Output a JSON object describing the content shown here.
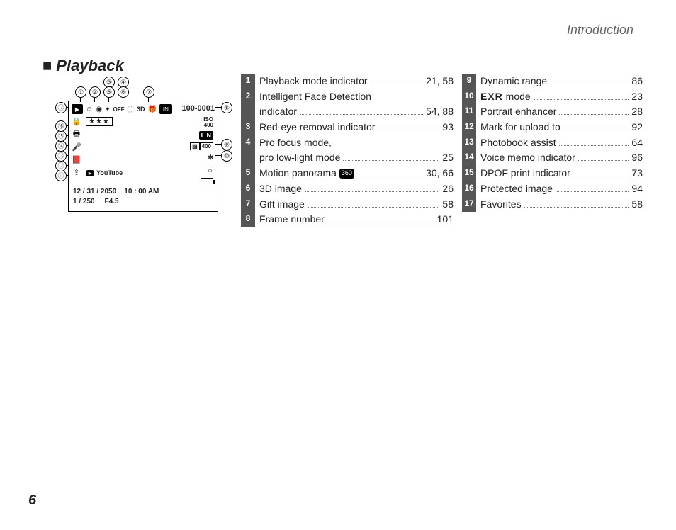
{
  "header": {
    "running": "Introduction"
  },
  "section": {
    "marker": "■",
    "title": "Playback"
  },
  "footer": {
    "page": "6"
  },
  "lcd": {
    "frame_number": "100-0001",
    "iso_label": "ISO",
    "iso_value": "400",
    "size_quality": "L N",
    "dynamic_badge": "400",
    "stars": "★★★",
    "youtube": "YouTube",
    "date": "12 / 31 / 2050",
    "time": "10 : 00  AM",
    "shutter": "1 / 250",
    "aperture": "F4.5"
  },
  "callouts_top": [
    "①",
    "②",
    "③",
    "④",
    "⑤",
    "⑥",
    "⑦"
  ],
  "callouts_side": [
    "⑧",
    "⑨",
    "⑩",
    "⑪",
    "⑫",
    "⑬",
    "⑭",
    "⑮",
    "⑯",
    "⑰"
  ],
  "legend_left": [
    {
      "n": "1",
      "lines": [
        {
          "label": "Playback mode indicator",
          "pg": "21, 58"
        }
      ]
    },
    {
      "n": "2",
      "lines": [
        {
          "label": "Intelligent Face Detection",
          "pg": ""
        },
        {
          "label": "indicator",
          "pg": "54, 88"
        }
      ]
    },
    {
      "n": "3",
      "lines": [
        {
          "label": "Red-eye removal indicator",
          "pg": "93"
        }
      ]
    },
    {
      "n": "4",
      "lines": [
        {
          "label": "Pro focus mode,",
          "pg": ""
        },
        {
          "label": "pro low-light mode",
          "pg": "25"
        }
      ]
    },
    {
      "n": "5",
      "lines": [
        {
          "label": "Motion panorama ",
          "icon": "360",
          "pg": "30, 66"
        }
      ]
    },
    {
      "n": "6",
      "lines": [
        {
          "label": "3D image",
          "pg": "26"
        }
      ]
    },
    {
      "n": "7",
      "lines": [
        {
          "label": "Gift image",
          "pg": "58"
        }
      ]
    },
    {
      "n": "8",
      "lines": [
        {
          "label": "Frame number",
          "pg": "101"
        }
      ]
    }
  ],
  "legend_right": [
    {
      "n": "9",
      "lines": [
        {
          "label": "Dynamic range",
          "pg": "86"
        }
      ]
    },
    {
      "n": "10",
      "lines": [
        {
          "label": "",
          "exr": true,
          "suffix": " mode",
          "pg": "23"
        }
      ]
    },
    {
      "n": "11",
      "lines": [
        {
          "label": "Portrait enhancer",
          "pg": "28"
        }
      ]
    },
    {
      "n": "12",
      "lines": [
        {
          "label": "Mark for upload to",
          "pg": "92"
        }
      ]
    },
    {
      "n": "13",
      "lines": [
        {
          "label": "Photobook assist",
          "pg": "64"
        }
      ]
    },
    {
      "n": "14",
      "lines": [
        {
          "label": "Voice memo indicator",
          "pg": "96"
        }
      ]
    },
    {
      "n": "15",
      "lines": [
        {
          "label": "DPOF print indicator",
          "pg": "73"
        }
      ]
    },
    {
      "n": "16",
      "lines": [
        {
          "label": "Protected image",
          "pg": "94"
        }
      ]
    },
    {
      "n": "17",
      "lines": [
        {
          "label": "Favorites",
          "pg": "58"
        }
      ]
    }
  ]
}
